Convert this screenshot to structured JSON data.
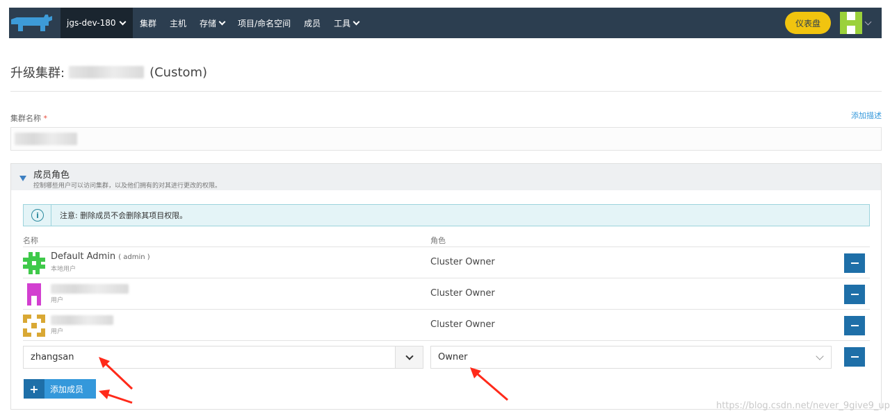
{
  "navbar": {
    "cluster_name": "jgs-dev-180",
    "items": [
      {
        "label": "集群",
        "dropdown": false
      },
      {
        "label": "主机",
        "dropdown": false
      },
      {
        "label": "存储",
        "dropdown": true
      },
      {
        "label": "项目/命名空间",
        "dropdown": false
      },
      {
        "label": "成员",
        "dropdown": false
      },
      {
        "label": "工具",
        "dropdown": true
      }
    ],
    "dashboard_label": "仪表盘"
  },
  "page": {
    "title_prefix": "升级集群:",
    "title_suffix": "(Custom)"
  },
  "cluster_name_field": {
    "label": "集群名称",
    "required_mark": "*",
    "add_description": "添加描述"
  },
  "members_panel": {
    "title": "成员角色",
    "subtitle": "控制哪些用户可以访问集群，以及他们拥有的对其进行更改的权限。",
    "notice": "注意: 删除成员不会删除其项目权限。",
    "col_name": "名称",
    "col_role": "角色",
    "members": [
      {
        "name": "Default Admin",
        "username": "( admin )",
        "type": "本地用户",
        "role": "Cluster Owner"
      },
      {
        "name": "",
        "username": "",
        "type": "用户",
        "role": "Cluster Owner"
      },
      {
        "name": "",
        "username": "",
        "type": "用户",
        "role": "Cluster Owner"
      }
    ],
    "new_member": {
      "user_value": "zhangsan",
      "role_value": "Owner"
    },
    "add_member_label": "添加成员"
  },
  "watermark": "https://blog.csdn.net/never_9give9_up",
  "colors": {
    "navbar": "#2c3e50",
    "accent": "#3498db",
    "dashboard": "#f1c40f",
    "arrow": "#ff2a1a"
  }
}
